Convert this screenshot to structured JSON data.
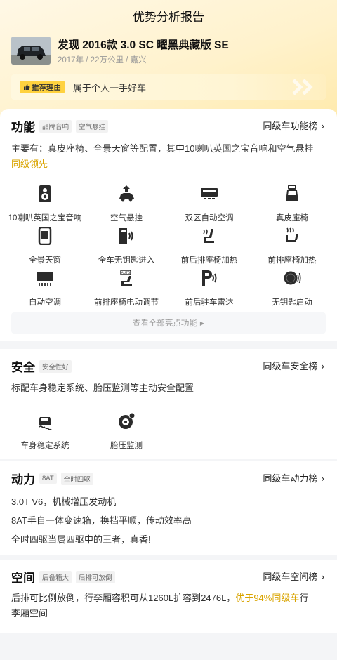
{
  "header": {
    "title": "优势分析报告"
  },
  "car": {
    "name": "发现 2016款 3.0 SC 曜黑典藏版 SE",
    "meta": "2017年 / 22万公里 / 嘉兴",
    "reason_tag": "推荐理由",
    "reason_text": "属于个人一手好车"
  },
  "function": {
    "title": "功能",
    "chips": [
      "品牌音响",
      "空气悬挂"
    ],
    "rank_label": "同级车功能榜",
    "desc_main": "主要有：真皮座椅、全景天窗等配置，其中10喇叭英国之宝音响和空气悬挂",
    "desc_hl": "同级领先",
    "features": [
      {
        "label": "10喇叭英国之宝音响",
        "icon": "speaker-icon"
      },
      {
        "label": "空气悬挂",
        "icon": "air-suspension-icon"
      },
      {
        "label": "双区自动空调",
        "icon": "dual-zone-ac-icon"
      },
      {
        "label": "真皮座椅",
        "icon": "leather-seat-icon"
      },
      {
        "label": "全景天窗",
        "icon": "panoramic-sunroof-icon"
      },
      {
        "label": "全车无钥匙进入",
        "icon": "keyless-entry-icon"
      },
      {
        "label": "前后排座椅加热",
        "icon": "seat-heating-icon"
      },
      {
        "label": "前排座椅加热",
        "icon": "front-seat-heating-icon"
      },
      {
        "label": "自动空调",
        "icon": "auto-ac-icon"
      },
      {
        "label": "前排座椅电动调节",
        "icon": "power-seat-icon"
      },
      {
        "label": "前后驻车雷达",
        "icon": "parking-radar-icon"
      },
      {
        "label": "无钥匙启动",
        "icon": "keyless-start-icon"
      }
    ],
    "view_all": "查看全部亮点功能"
  },
  "safety": {
    "title": "安全",
    "chips": [
      "安全性好"
    ],
    "rank_label": "同级车安全榜",
    "desc": "标配车身稳定系统、胎压监测等主动安全配置",
    "features": [
      {
        "label": "车身稳定系统",
        "icon": "stability-control-icon"
      },
      {
        "label": "胎压监测",
        "icon": "tire-pressure-icon"
      }
    ]
  },
  "power": {
    "title": "动力",
    "chips": [
      "8AT",
      "全时四驱"
    ],
    "rank_label": "同级车动力榜",
    "lines": [
      "3.0T V6，机械增压发动机",
      "8AT手自一体变速箱，换挡平顺，传动效率高",
      "全时四驱当属四驱中的王者，真香!"
    ]
  },
  "space": {
    "title": "空间",
    "chips": [
      "后备箱大",
      "后排可放倒"
    ],
    "rank_label": "同级车空间榜",
    "desc_pre": "后排可比例放倒，行李厢容积可从1260L扩容到2476L，",
    "desc_hl": "优于94%同级车",
    "desc_post": "行",
    "desc_line2": "李厢空间"
  },
  "colors": {
    "accent": "#ffd23f",
    "highlight": "#d9a400"
  }
}
